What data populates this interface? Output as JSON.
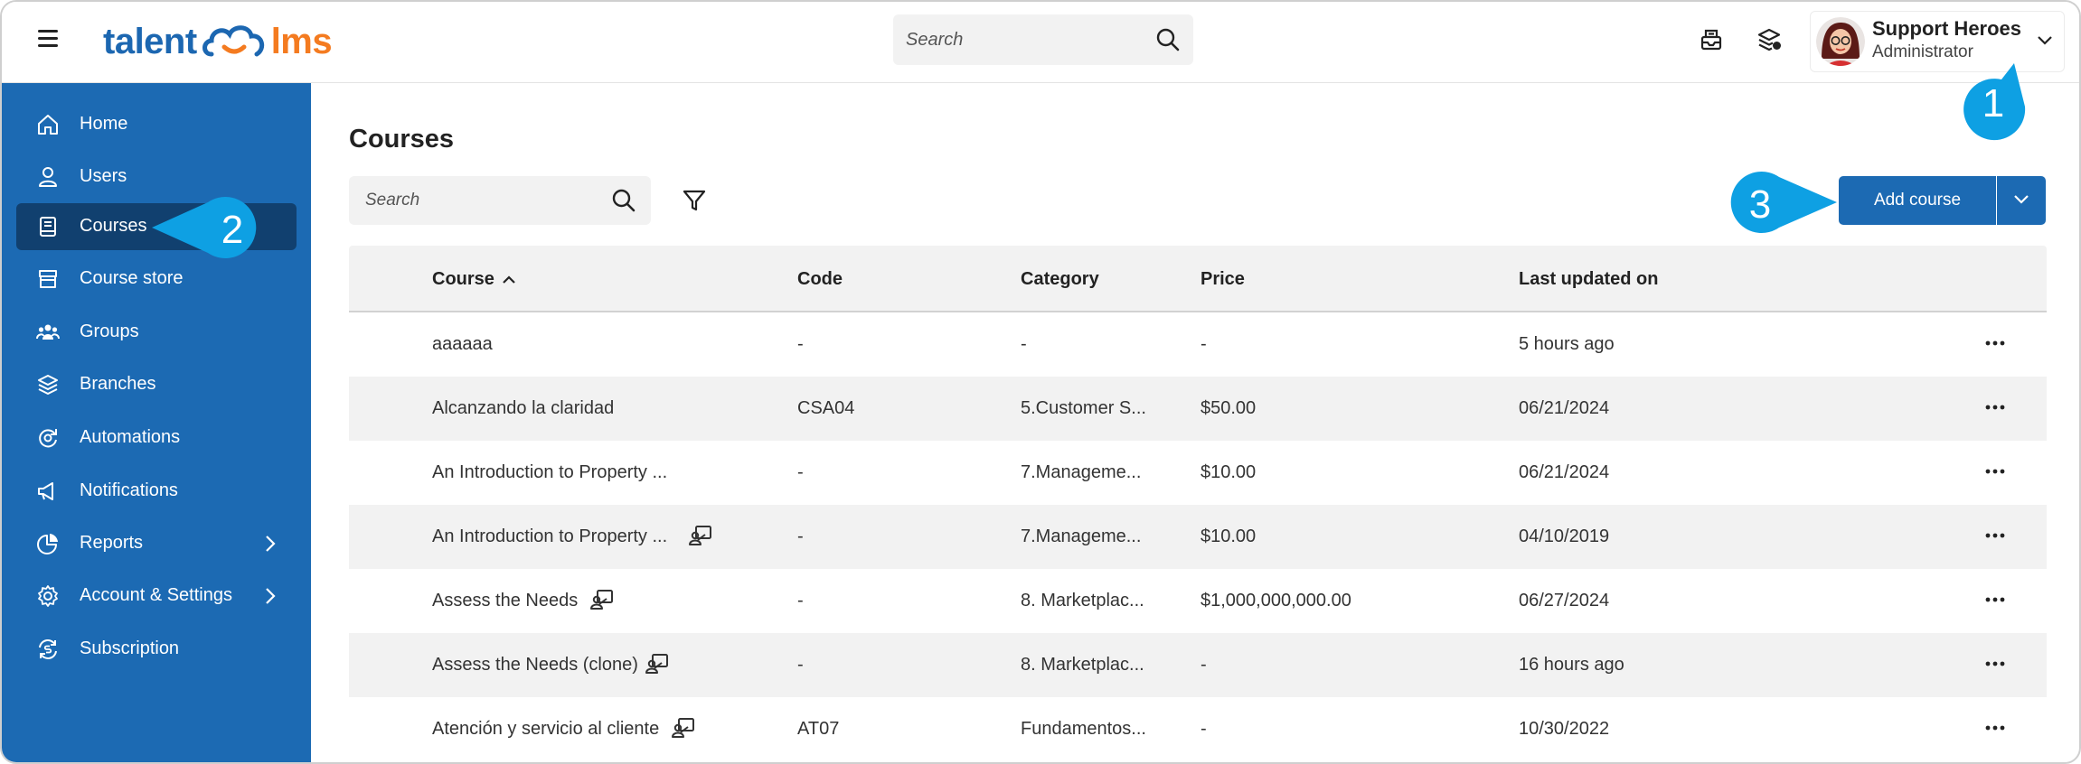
{
  "brand": {
    "part1": "talent",
    "part2": "lms"
  },
  "topbar": {
    "search_placeholder": "Search",
    "user_name": "Support Heroes",
    "user_role": "Administrator"
  },
  "sidebar": {
    "items": [
      {
        "label": "Home",
        "icon": "home-icon"
      },
      {
        "label": "Users",
        "icon": "user-icon"
      },
      {
        "label": "Courses",
        "icon": "book-icon",
        "active": true
      },
      {
        "label": "Course store",
        "icon": "store-icon"
      },
      {
        "label": "Groups",
        "icon": "groups-icon"
      },
      {
        "label": "Branches",
        "icon": "layers-icon"
      },
      {
        "label": "Automations",
        "icon": "automation-icon"
      },
      {
        "label": "Notifications",
        "icon": "megaphone-icon"
      },
      {
        "label": "Reports",
        "icon": "pie-chart-icon",
        "has_submenu": true
      },
      {
        "label": "Account & Settings",
        "icon": "gear-icon",
        "has_submenu": true
      },
      {
        "label": "Subscription",
        "icon": "subscription-icon"
      }
    ]
  },
  "main": {
    "title": "Courses",
    "search_placeholder": "Search",
    "add_button": "Add course"
  },
  "table": {
    "columns": [
      "Course",
      "Code",
      "Category",
      "Price",
      "Last updated on"
    ],
    "rows": [
      {
        "course": "aaaaaa",
        "code": "-",
        "category": "-",
        "price": "-",
        "updated": "5 hours ago",
        "ilt": false
      },
      {
        "course": "Alcanzando la claridad",
        "code": "CSA04",
        "category": "5.Customer S...",
        "price": "$50.00",
        "updated": "06/21/2024",
        "ilt": false
      },
      {
        "course": "An Introduction to Property ...",
        "code": "-",
        "category": "7.Manageme...",
        "price": "$10.00",
        "updated": "06/21/2024",
        "ilt": false
      },
      {
        "course": "An Introduction to Property ...",
        "code": "-",
        "category": "7.Manageme...",
        "price": "$10.00",
        "updated": "04/10/2019",
        "ilt": true
      },
      {
        "course": "Assess the Needs",
        "code": "-",
        "category": "8. Marketplac...",
        "price": "$1,000,000,000.00",
        "updated": "06/27/2024",
        "ilt": true
      },
      {
        "course": "Assess the Needs (clone)",
        "code": "-",
        "category": "8. Marketplac...",
        "price": "-",
        "updated": "16 hours ago",
        "ilt": true
      },
      {
        "course": "Atención y servicio al cliente",
        "code": "AT07",
        "category": "Fundamentos...",
        "price": "-",
        "updated": "10/30/2022",
        "ilt": true
      }
    ]
  },
  "callouts": [
    "1",
    "2",
    "3"
  ],
  "colors": {
    "primary": "#1c6ab3",
    "sidebar_active": "#11406f",
    "callout": "#0ea0e3",
    "brand_orange": "#f47b20"
  }
}
